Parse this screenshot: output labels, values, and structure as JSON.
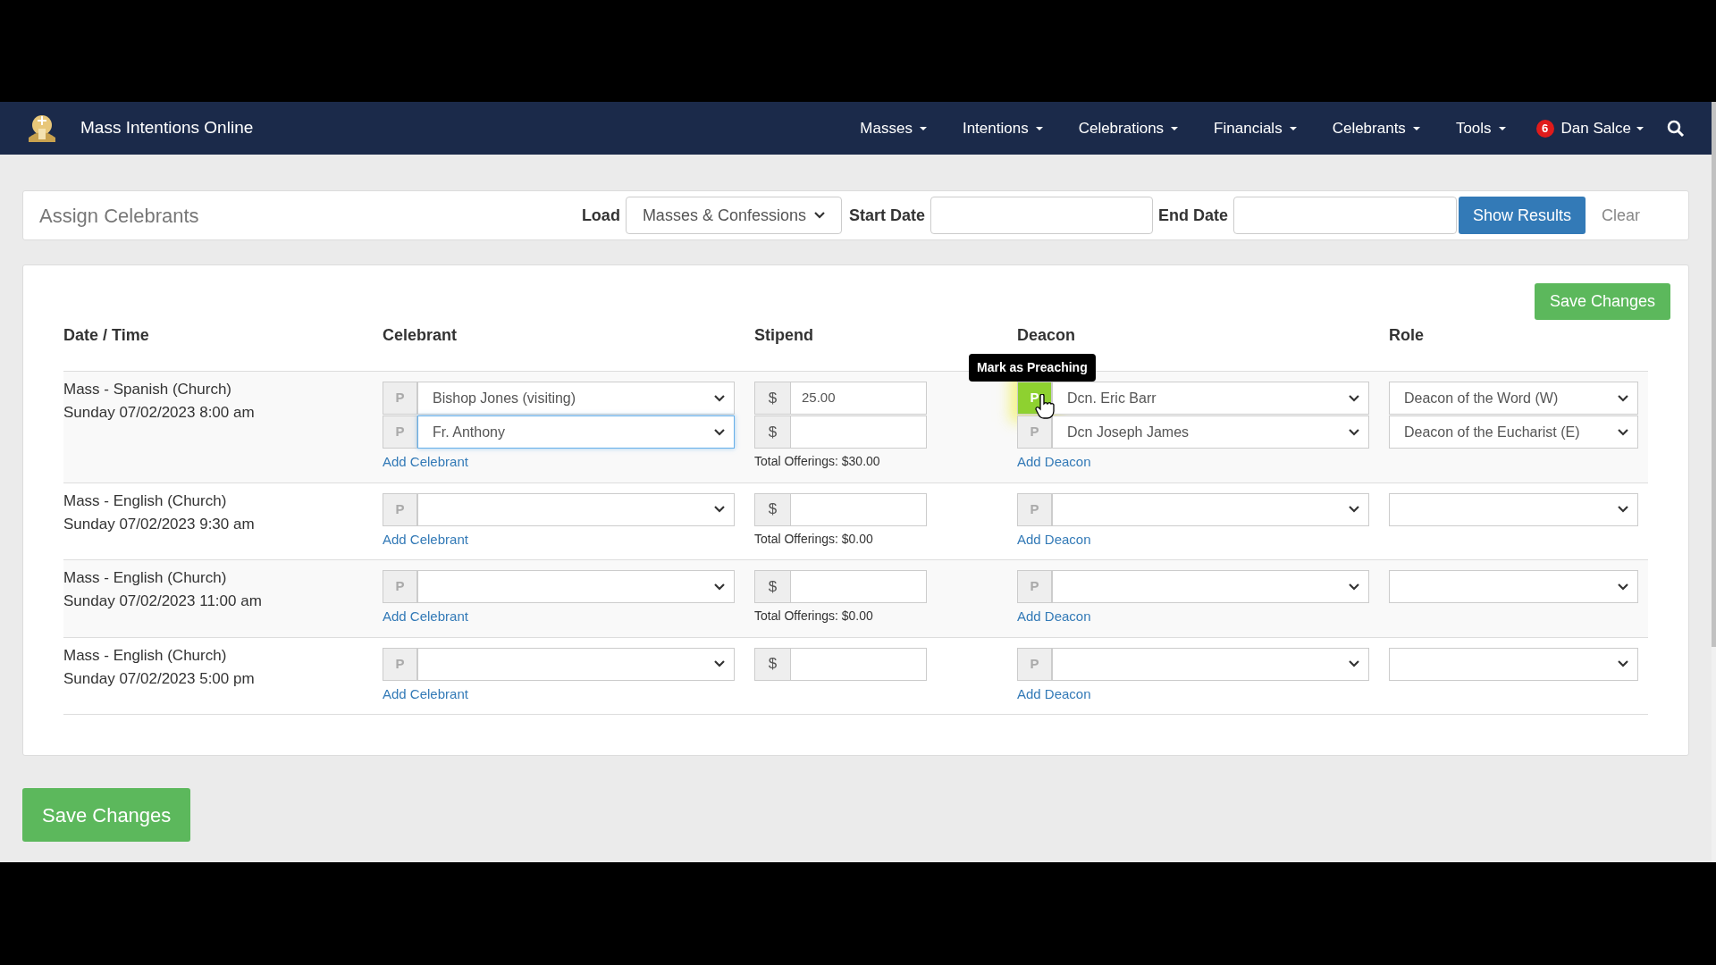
{
  "navbar": {
    "brand": "Mass Intentions Online",
    "menus": [
      {
        "label": "Masses"
      },
      {
        "label": "Intentions"
      },
      {
        "label": "Celebrations"
      },
      {
        "label": "Financials"
      },
      {
        "label": "Celebrants"
      },
      {
        "label": "Tools"
      }
    ],
    "user": {
      "badge": "6",
      "name": "Dan Salce"
    }
  },
  "filter": {
    "title": "Assign Celebrants",
    "load_label": "Load",
    "load_value": "Masses & Confessions",
    "start_label": "Start Date",
    "end_label": "End Date",
    "show_button": "Show Results",
    "clear_button": "Clear"
  },
  "save_top": "Save Changes",
  "columns": [
    "Date / Time",
    "Celebrant",
    "Stipend",
    "Deacon",
    "Role"
  ],
  "rows": [
    {
      "title": "Mass - Spanish (Church)",
      "when": "Sunday 07/02/2023 8:00 am",
      "celebrants": [
        {
          "toggle": "P",
          "preaching": false,
          "value": "Bishop Jones (visiting)",
          "focused": false
        },
        {
          "toggle": "P",
          "preaching": false,
          "value": "Fr. Anthony",
          "focused": true
        }
      ],
      "add_celebrant": "Add Celebrant",
      "stipends": [
        {
          "prefix": "$",
          "value": "25.00"
        },
        {
          "prefix": "$"
        }
      ],
      "total": "Total Offerings: $30.00",
      "deacons": [
        {
          "toggle": "P",
          "preaching": true,
          "value": "Dcn. Eric Barr",
          "tooltip": "Mark as Preaching"
        },
        {
          "toggle": "P",
          "preaching": false,
          "value": "Dcn Joseph James"
        }
      ],
      "add_deacon": "Add Deacon",
      "roles": [
        {
          "kind": "select",
          "value": "Deacon of the Word (W)"
        },
        {
          "kind": "select",
          "value": "Deacon of the Eucharist (E)"
        }
      ]
    },
    {
      "title": "Mass - English (Church)",
      "when": "Sunday 07/02/2023 9:30 am",
      "celebrants": [
        {
          "toggle": "P",
          "preaching": false,
          "focused": false
        }
      ],
      "add_celebrant": "Add Celebrant",
      "stipends": [
        {
          "prefix": "$"
        }
      ],
      "total": "Total Offerings: $0.00",
      "deacons": [
        {
          "toggle": "P",
          "preaching": false
        }
      ],
      "add_deacon": "Add Deacon",
      "roles": [
        {
          "kind": "select"
        }
      ]
    },
    {
      "title": "Mass - English (Church)",
      "when": "Sunday 07/02/2023 11:00 am",
      "celebrants": [
        {
          "toggle": "P",
          "preaching": false,
          "focused": false
        }
      ],
      "add_celebrant": "Add Celebrant",
      "stipends": [
        {
          "prefix": "$"
        }
      ],
      "total": "Total Offerings: $0.00",
      "deacons": [
        {
          "toggle": "P",
          "preaching": false
        }
      ],
      "add_deacon": "Add Deacon",
      "roles": [
        {
          "kind": "select"
        }
      ]
    },
    {
      "title": "Mass - English (Church)",
      "when": "Sunday 07/02/2023 5:00 pm",
      "celebrants": [
        {
          "toggle": "P",
          "preaching": false,
          "focused": false
        }
      ],
      "add_celebrant": "Add Celebrant",
      "stipends": [
        {
          "prefix": "$"
        }
      ],
      "deacons": [
        {
          "toggle": "P",
          "preaching": false
        }
      ],
      "add_deacon": "Add Deacon",
      "roles": [
        {
          "kind": "select"
        }
      ]
    }
  ],
  "save_bottom": "Save Changes"
}
